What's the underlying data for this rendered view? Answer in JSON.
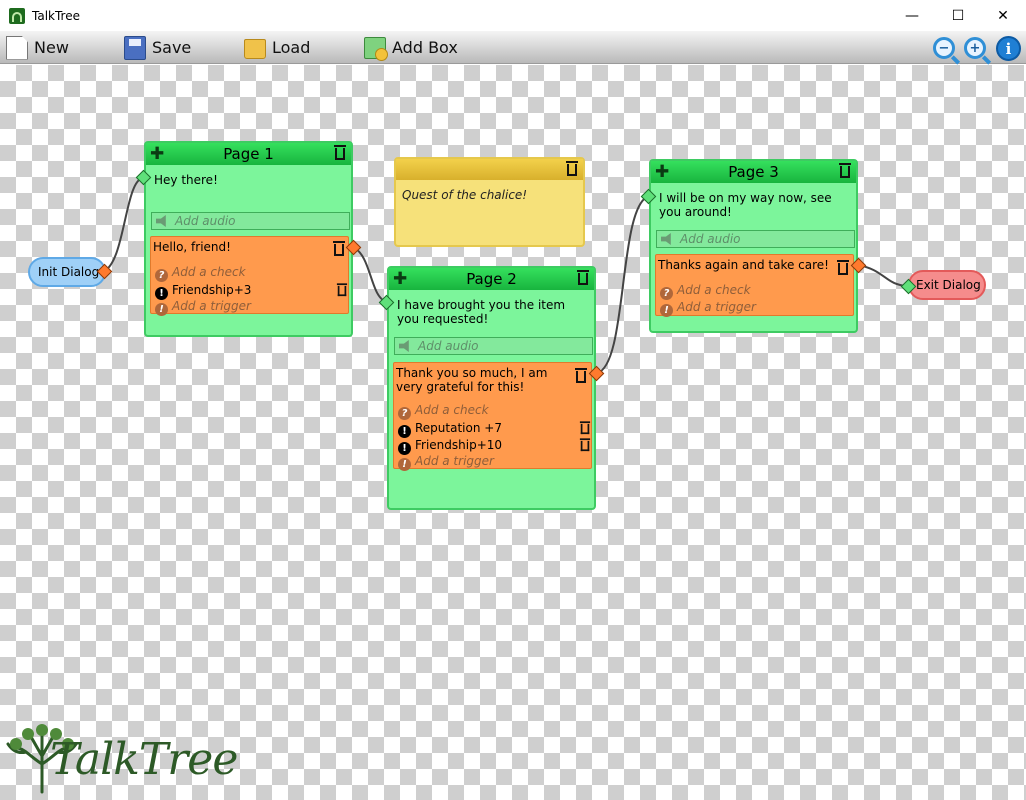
{
  "window": {
    "title": "TalkTree",
    "minimize": "—",
    "maximize": "☐",
    "close": "✕"
  },
  "toolbar": {
    "new_label": "New",
    "save_label": "Save",
    "load_label": "Load",
    "add_box_label": "Add Box"
  },
  "zoom": {
    "out_sign": "−",
    "in_sign": "+",
    "info_sign": "i"
  },
  "endpoints": {
    "init": "Init Dialog",
    "exit": "Exit Dialog"
  },
  "note": {
    "text": "Quest of the chalice!"
  },
  "pages": {
    "p1": {
      "title": "Page 1",
      "text": "Hey there!",
      "audio": "Add audio",
      "response": {
        "text": "Hello, friend!",
        "check": "Add a check",
        "triggers": [
          "Friendship+3"
        ],
        "add_trigger": "Add a trigger"
      }
    },
    "p2": {
      "title": "Page 2",
      "text": "I have brought you the item you requested!",
      "audio": "Add audio",
      "response": {
        "text": "Thank you so much, I am very grateful for this!",
        "check": "Add a check",
        "triggers": [
          "Reputation +7",
          "Friendship+10"
        ],
        "add_trigger": "Add a trigger"
      }
    },
    "p3": {
      "title": "Page 3",
      "text": "I will be on my way now, see you around!",
      "audio": "Add audio",
      "response": {
        "text": "Thanks again and take care!",
        "check": "Add a check",
        "triggers": [],
        "add_trigger": "Add a trigger"
      }
    }
  },
  "logo": {
    "text": "TalkTree"
  },
  "colors": {
    "page_fill": "#7cf59b",
    "page_header": "#22c447",
    "response_fill": "#ff9a4d",
    "note_fill": "#f6e17a",
    "init_fill": "#9fd0f7",
    "exit_fill": "#f58c8c"
  }
}
